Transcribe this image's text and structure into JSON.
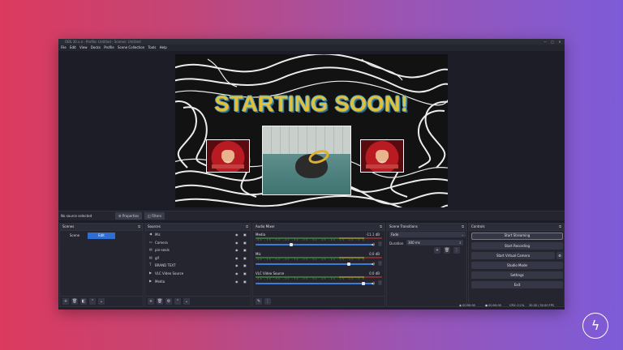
{
  "window": {
    "title": "OBS 30.x.x - Profile: Untitled - Scenes: Untitled",
    "controls": [
      "—",
      "□",
      "✕"
    ]
  },
  "menu": [
    "File",
    "Edit",
    "View",
    "Docks",
    "Profile",
    "Scene Collection",
    "Tools",
    "Help"
  ],
  "preview": {
    "headline": "STARTING SOON!",
    "headline_color": "#e2c038",
    "outline_color": "#4f9fbf"
  },
  "status_bar": {
    "message": "No source selected",
    "properties_label": "Properties",
    "filters_label": "Filters"
  },
  "scenes": {
    "title": "Scenes",
    "items": [
      {
        "label": "Scene",
        "active": false
      },
      {
        "label": "Edit",
        "active": true
      }
    ],
    "footer": [
      "+",
      "🗑",
      "◧",
      "⌃",
      "⌄"
    ]
  },
  "sources": {
    "title": "Sources",
    "items": [
      {
        "icon": "speaker",
        "label": "Mic"
      },
      {
        "icon": "monitor",
        "label": "Camera"
      },
      {
        "icon": "image",
        "label": "pin-seals"
      },
      {
        "icon": "image",
        "label": "gif"
      },
      {
        "icon": "text",
        "label": "BRAND TEXT"
      },
      {
        "icon": "play",
        "label": "VLC Video Source"
      },
      {
        "icon": "play",
        "label": "Media"
      }
    ],
    "footer": [
      "+",
      "🗑",
      "⚙",
      "⌃",
      "⌄"
    ]
  },
  "audio_mixer": {
    "title": "Audio Mixer",
    "ticks": "-60 -55 -50 -45 -40 -35 -30 -25 -20 -15 -10 -5 0",
    "channels": [
      {
        "name": "Media",
        "db": "-11.1 dB",
        "level": 0.3
      },
      {
        "name": "Mic",
        "db": "0.0 dB",
        "level": 0.8
      },
      {
        "name": "VLC Video Source",
        "db": "0.0 dB",
        "level": 0.93
      }
    ]
  },
  "transitions": {
    "title": "Scene Transitions",
    "type": "Fade",
    "duration_label": "Duration",
    "duration_value": "300 ms"
  },
  "controls": {
    "title": "Controls",
    "buttons": [
      "Start Streaming",
      "Start Recording",
      "Start Virtual Camera",
      "Studio Mode",
      "Settings",
      "Exit"
    ],
    "highlight_color": "#e0467a"
  },
  "bottom_status": {
    "live": "00:00:00",
    "rec": "00:00:00",
    "cpu": "CPU: 0.1%",
    "fps": "30.00 / 30.00 FPS"
  },
  "badge_icon": "lightning-bolt-icon"
}
